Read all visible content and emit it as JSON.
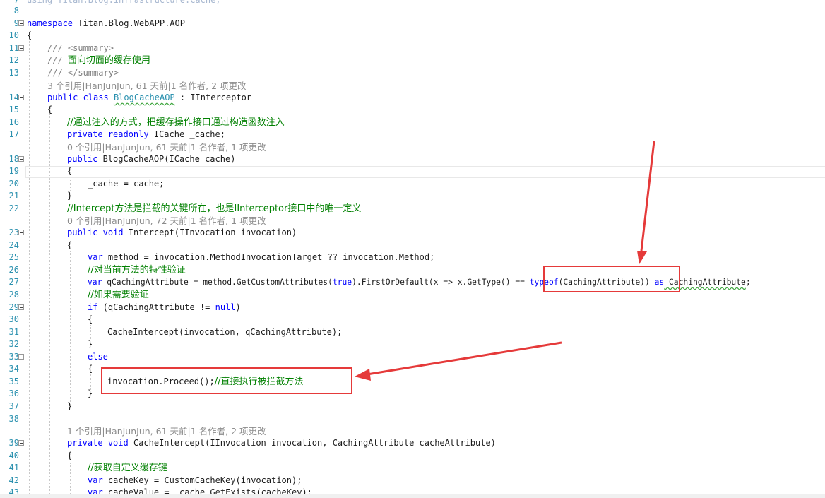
{
  "top_clip": "using Titan.Blog.Infrastructure.Cache;",
  "line_numbers": [
    "8",
    "9",
    "10",
    "11",
    "12",
    "13",
    "14",
    "15",
    "16",
    "17",
    "18",
    "19",
    "20",
    "21",
    "22",
    "23",
    "24",
    "25",
    "26",
    "27",
    "28",
    "29",
    "30",
    "31",
    "32",
    "33",
    "34",
    "35",
    "36",
    "37",
    "38",
    "39",
    "40",
    "41",
    "42",
    "43"
  ],
  "code": {
    "l9": {
      "ns_kw": "namespace",
      "ns_name": " Titan.Blog.WebAPP.AOP"
    },
    "l10": "{",
    "l11": {
      "slashes": "/// ",
      "tag": "<summary>"
    },
    "l12": {
      "slashes": "/// ",
      "text": "面向切面的缓存使用"
    },
    "l13": {
      "slashes": "/// ",
      "tag": "</summary>"
    },
    "lens1": "3 个引用|HanJunJun, 61 天前|1 名作者, 2 项更改",
    "l14": {
      "kw1": "public",
      "kw2": "class",
      "cls": "BlogCacheAOP",
      "rest": " : IInterceptor"
    },
    "l15": "{",
    "l16": "//通过注入的方式，把缓存操作接口通过构造函数注入",
    "l17": {
      "kw1": "private",
      "kw2": "readonly",
      "rest": " ICache _cache;"
    },
    "lens2": "0 个引用|HanJunJun, 61 天前|1 名作者, 1 项更改",
    "l18": {
      "kw": "public",
      "rest": " BlogCacheAOP(ICache cache)"
    },
    "l19": "{",
    "l20": "_cache = cache;",
    "l21": "}",
    "l22": "//Intercept方法是拦截的关键所在，也是IInterceptor接口中的唯一定义",
    "lens3": "0 个引用|HanJunJun, 72 天前|1 名作者, 1 项更改",
    "l23": {
      "kw1": "public",
      "kw2": "void",
      "rest": " Intercept(IInvocation invocation)"
    },
    "l24": "{",
    "l25": {
      "kw": "var",
      "rest": " method = invocation.MethodInvocationTarget ?? invocation.Method;"
    },
    "l26": "//对当前方法的特性验证",
    "l27": {
      "kw": "var",
      "a": " qCachingAttribute = method.GetCustomAttributes(",
      "true": "true",
      "b": ").FirstOrDefault(x => x.GetType() == ",
      "typeof": "typeof",
      "c": "(CachingAttribute))",
      "as": " as",
      "d": " CachingAttribute",
      "e": ";"
    },
    "l28": "//如果需要验证",
    "l29": {
      "kw": "if",
      "a": " (qCachingAttribute != ",
      "null": "null",
      "b": ")"
    },
    "l30": "{",
    "l31": "CacheIntercept(invocation, qCachingAttribute);",
    "l32": "}",
    "l33": "else",
    "l34": "{",
    "l35": {
      "code": "invocation.Proceed();",
      "comment": "//直接执行被拦截方法"
    },
    "l36": "}",
    "l37": "}",
    "lens4": "1 个引用|HanJunJun, 61 天前|1 名作者, 2 项更改",
    "l39": {
      "kw1": "private",
      "kw2": "void",
      "rest": " CacheIntercept(IInvocation invocation, CachingAttribute cacheAttribute)"
    },
    "l40": "{",
    "l41": "//获取自定义缓存键",
    "l42": {
      "kw": "var",
      "rest": " cacheKey = CustomCacheKey(invocation);"
    },
    "l43": {
      "kw": "var",
      "rest": " cacheValue = _cache.GetExists(cacheKey);"
    }
  },
  "colors": {
    "keyword": "#0000ff",
    "type": "#2b91af",
    "comment": "#008000",
    "xml_tag": "#808080",
    "codelens": "#8c8c8c",
    "line_number": "#2b91af",
    "annotation_red": "#e53a3a"
  }
}
